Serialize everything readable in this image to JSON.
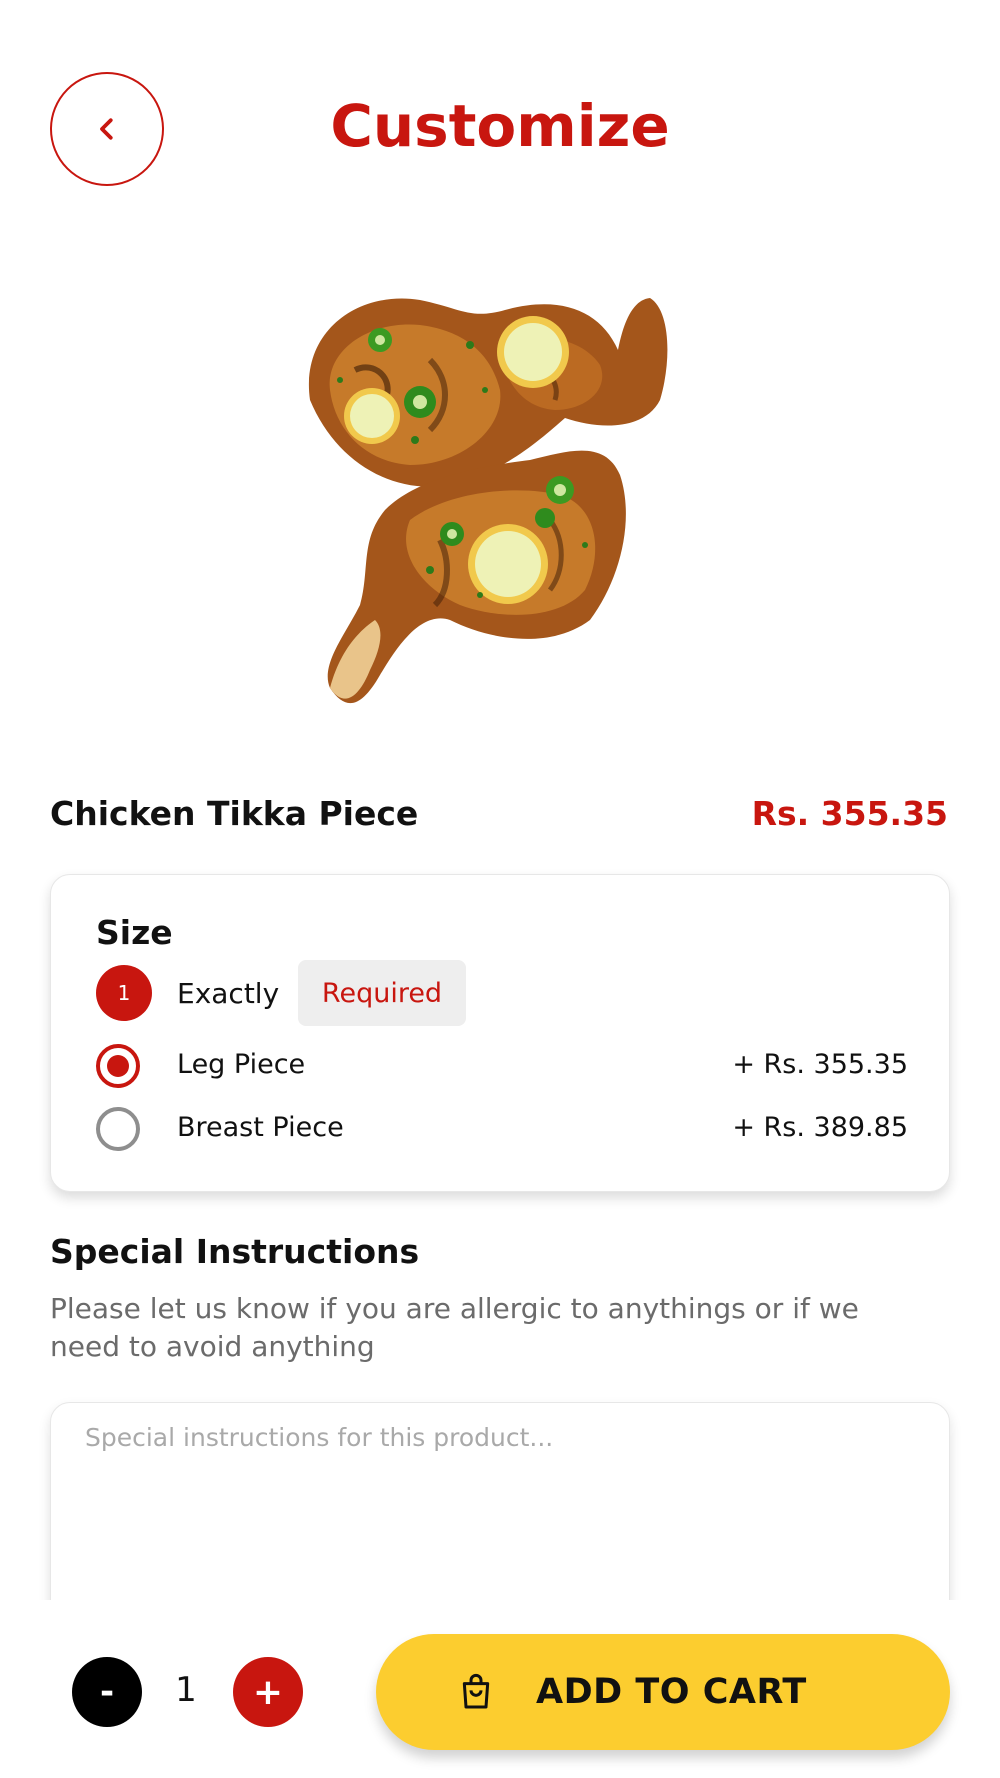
{
  "header": {
    "title": "Customize",
    "back_icon": "chevron-left-icon"
  },
  "product": {
    "name": "Chicken Tikka Piece",
    "price": "Rs. 355.35",
    "image": "grilled-chicken-tikka-image"
  },
  "size": {
    "title": "Size",
    "count": "1",
    "count_label": "Exactly",
    "required_label": "Required",
    "options": [
      {
        "label": "Leg Piece",
        "price": "+ Rs. 355.35",
        "selected": true
      },
      {
        "label": "Breast Piece",
        "price": "+ Rs. 389.85",
        "selected": false
      }
    ]
  },
  "special_instructions": {
    "title": "Special Instructions",
    "description": "Please let us know if you are allergic to anythings or if we need to avoid anything",
    "placeholder": "Special instructions for this product...",
    "value": ""
  },
  "footer": {
    "minus_label": "-",
    "quantity": "1",
    "plus_label": "+",
    "add_to_cart_label": "ADD TO CART",
    "cart_icon": "shopping-bag-icon"
  },
  "colors": {
    "accent": "#c8160f",
    "cta": "#fccd2f",
    "text": "#111111",
    "muted": "#6b6b6b"
  }
}
